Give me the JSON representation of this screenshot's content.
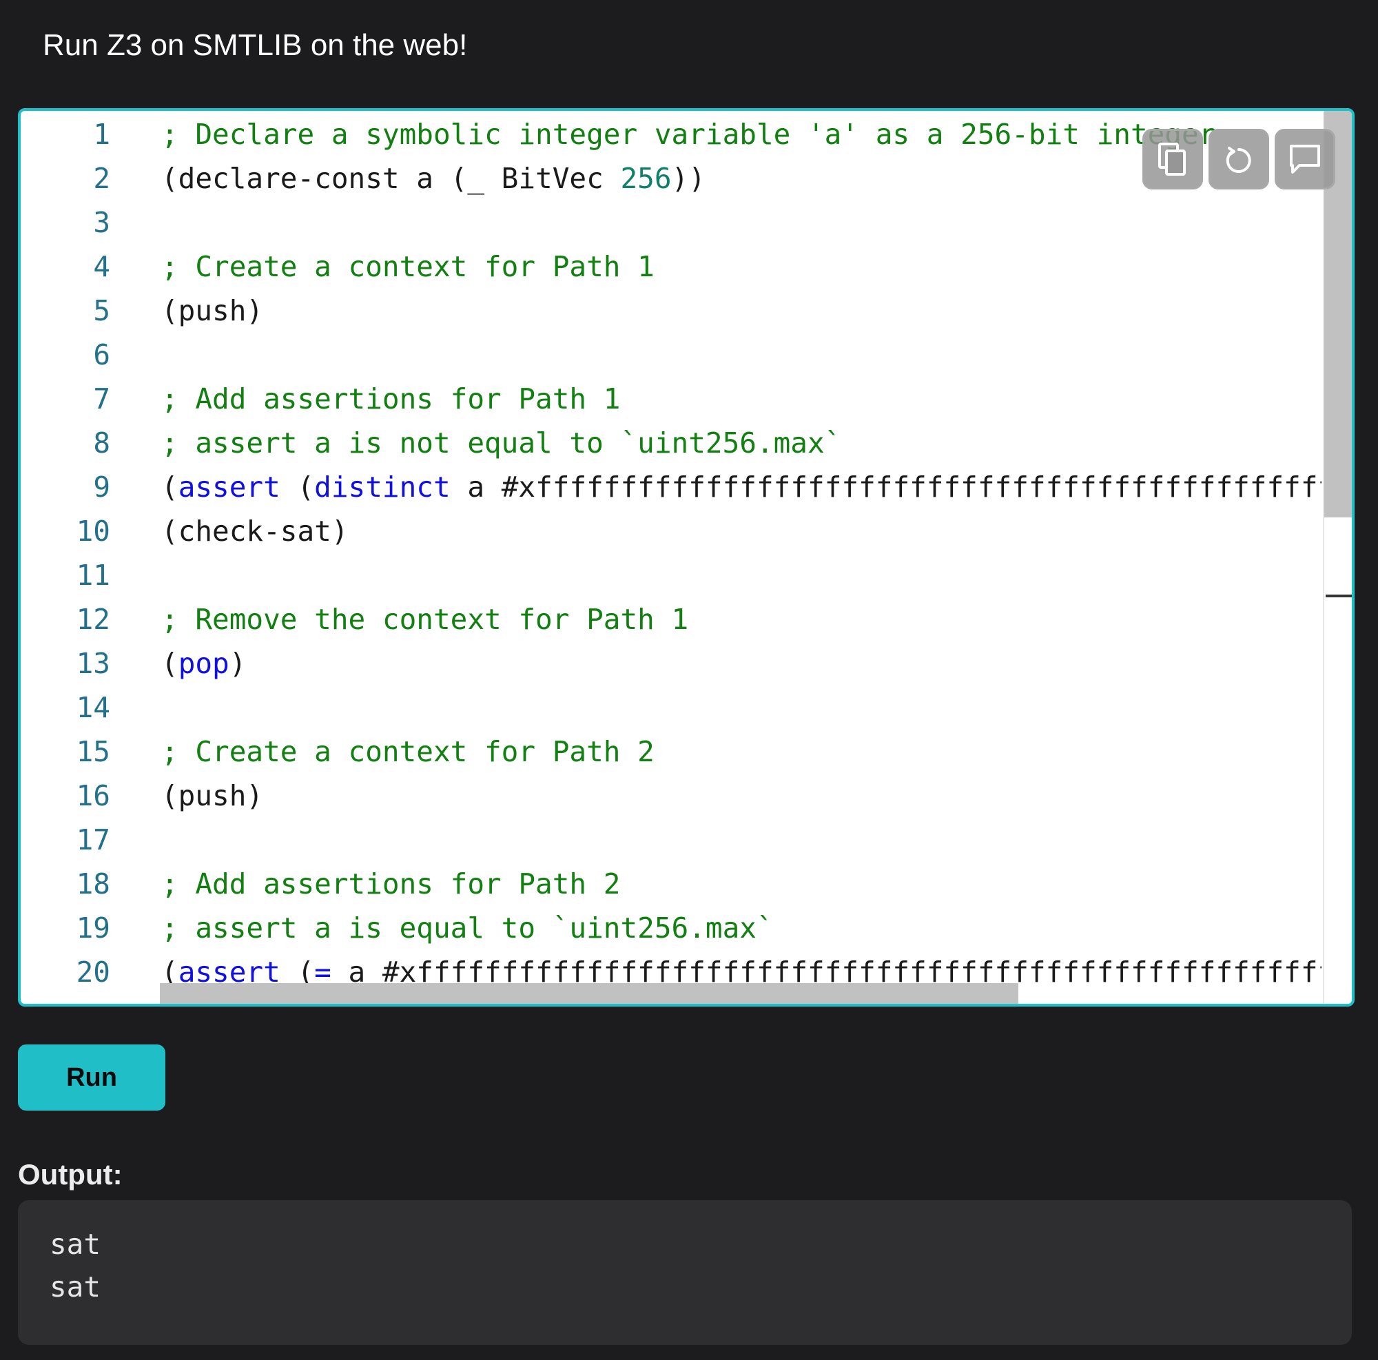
{
  "header": {
    "title": "Run Z3 on SMTLIB on the web!"
  },
  "editor": {
    "lines": [
      {
        "number": "1",
        "tokens": [
          {
            "t": "; Declare a symbolic integer variable 'a' as a 256-bit integer",
            "c": "comment"
          }
        ]
      },
      {
        "number": "2",
        "tokens": [
          {
            "t": "(declare-const a (_ BitVec ",
            "c": "plain"
          },
          {
            "t": "256",
            "c": "number"
          },
          {
            "t": "))",
            "c": "plain"
          }
        ]
      },
      {
        "number": "3",
        "tokens": []
      },
      {
        "number": "4",
        "tokens": [
          {
            "t": "; Create a context for Path 1",
            "c": "comment"
          }
        ]
      },
      {
        "number": "5",
        "tokens": [
          {
            "t": "(push)",
            "c": "plain"
          }
        ]
      },
      {
        "number": "6",
        "tokens": []
      },
      {
        "number": "7",
        "tokens": [
          {
            "t": "; Add assertions for Path 1",
            "c": "comment"
          }
        ]
      },
      {
        "number": "8",
        "tokens": [
          {
            "t": "; assert a is not equal to `uint256.max`",
            "c": "comment"
          }
        ]
      },
      {
        "number": "9",
        "tokens": [
          {
            "t": "(",
            "c": "plain"
          },
          {
            "t": "assert",
            "c": "keyword"
          },
          {
            "t": " (",
            "c": "plain"
          },
          {
            "t": "distinct",
            "c": "keyword"
          },
          {
            "t": " a #xffffffffffffffffffffffffffffffffffffffffffffffffffffffffffffffff))",
            "c": "plain"
          }
        ]
      },
      {
        "number": "10",
        "tokens": [
          {
            "t": "(check-sat)",
            "c": "plain"
          }
        ]
      },
      {
        "number": "11",
        "tokens": []
      },
      {
        "number": "12",
        "tokens": [
          {
            "t": "; Remove the context for Path 1",
            "c": "comment"
          }
        ]
      },
      {
        "number": "13",
        "tokens": [
          {
            "t": "(",
            "c": "plain"
          },
          {
            "t": "pop",
            "c": "keyword"
          },
          {
            "t": ")",
            "c": "plain"
          }
        ]
      },
      {
        "number": "14",
        "tokens": []
      },
      {
        "number": "15",
        "tokens": [
          {
            "t": "; Create a context for Path 2",
            "c": "comment"
          }
        ]
      },
      {
        "number": "16",
        "tokens": [
          {
            "t": "(push)",
            "c": "plain"
          }
        ]
      },
      {
        "number": "17",
        "tokens": []
      },
      {
        "number": "18",
        "tokens": [
          {
            "t": "; Add assertions for Path 2",
            "c": "comment"
          }
        ]
      },
      {
        "number": "19",
        "tokens": [
          {
            "t": "; assert a is equal to `uint256.max`",
            "c": "comment"
          }
        ]
      },
      {
        "number": "20",
        "tokens": [
          {
            "t": "(",
            "c": "plain"
          },
          {
            "t": "assert",
            "c": "keyword"
          },
          {
            "t": " (",
            "c": "plain"
          },
          {
            "t": "=",
            "c": "keyword"
          },
          {
            "t": " a #xffffffffffffffffffffffffffffffffffffffffffffffffffffffffffffffff))",
            "c": "plain"
          }
        ]
      }
    ],
    "toolbar": {
      "copy_icon": "copy-icon",
      "reset_icon": "reset-icon",
      "comment_icon": "comment-icon"
    },
    "border_color": "#1cc1c9"
  },
  "run": {
    "label": "Run",
    "color": "#20bfc7"
  },
  "output": {
    "label": "Output:",
    "lines": [
      "sat",
      "sat"
    ]
  },
  "colors": {
    "background": "#1c1c1e",
    "comment": "#118011",
    "keyword": "#1010e0",
    "number": "#11806a",
    "line_number": "#23708a"
  }
}
